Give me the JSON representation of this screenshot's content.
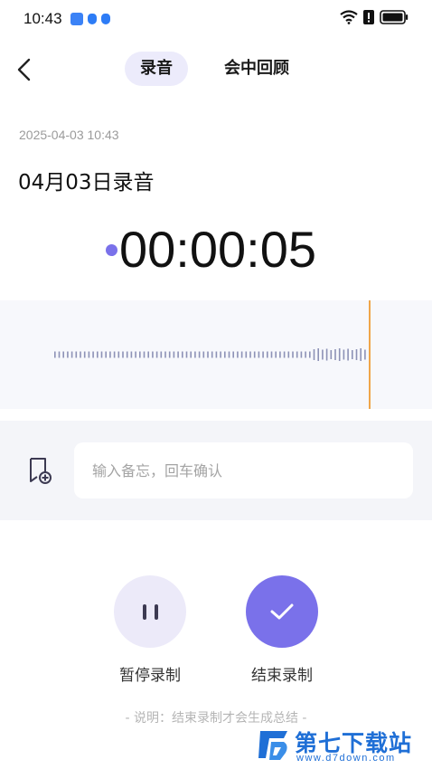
{
  "status_bar": {
    "time": "10:43",
    "left_icons": [
      "app-notification-icon",
      "shield-icon",
      "shield-icon"
    ],
    "right_icons": [
      "wifi-icon",
      "alert-icon",
      "battery-icon"
    ]
  },
  "nav": {
    "back_icon": "chevron-left-icon",
    "tabs": [
      {
        "label": "录音",
        "active": true
      },
      {
        "label": "会中回顾",
        "active": false
      }
    ]
  },
  "recording": {
    "datetime": "2025-04-03 10:43",
    "title": "04月03日录音",
    "timer": "00:00:05"
  },
  "memo": {
    "icon": "note-add-icon",
    "placeholder": "输入备忘，回车确认",
    "value": ""
  },
  "controls": {
    "pause_label": "暂停录制",
    "finish_label": "结束录制"
  },
  "hint": "- 说明：结束录制才会生成总结 -",
  "watermark": {
    "name": "第七下载站",
    "url": "www.d7down.com"
  },
  "colors": {
    "accent": "#7a71ea",
    "accent_light": "#eceaf9",
    "playhead": "#f0a64a",
    "wave": "#8d92b6"
  }
}
